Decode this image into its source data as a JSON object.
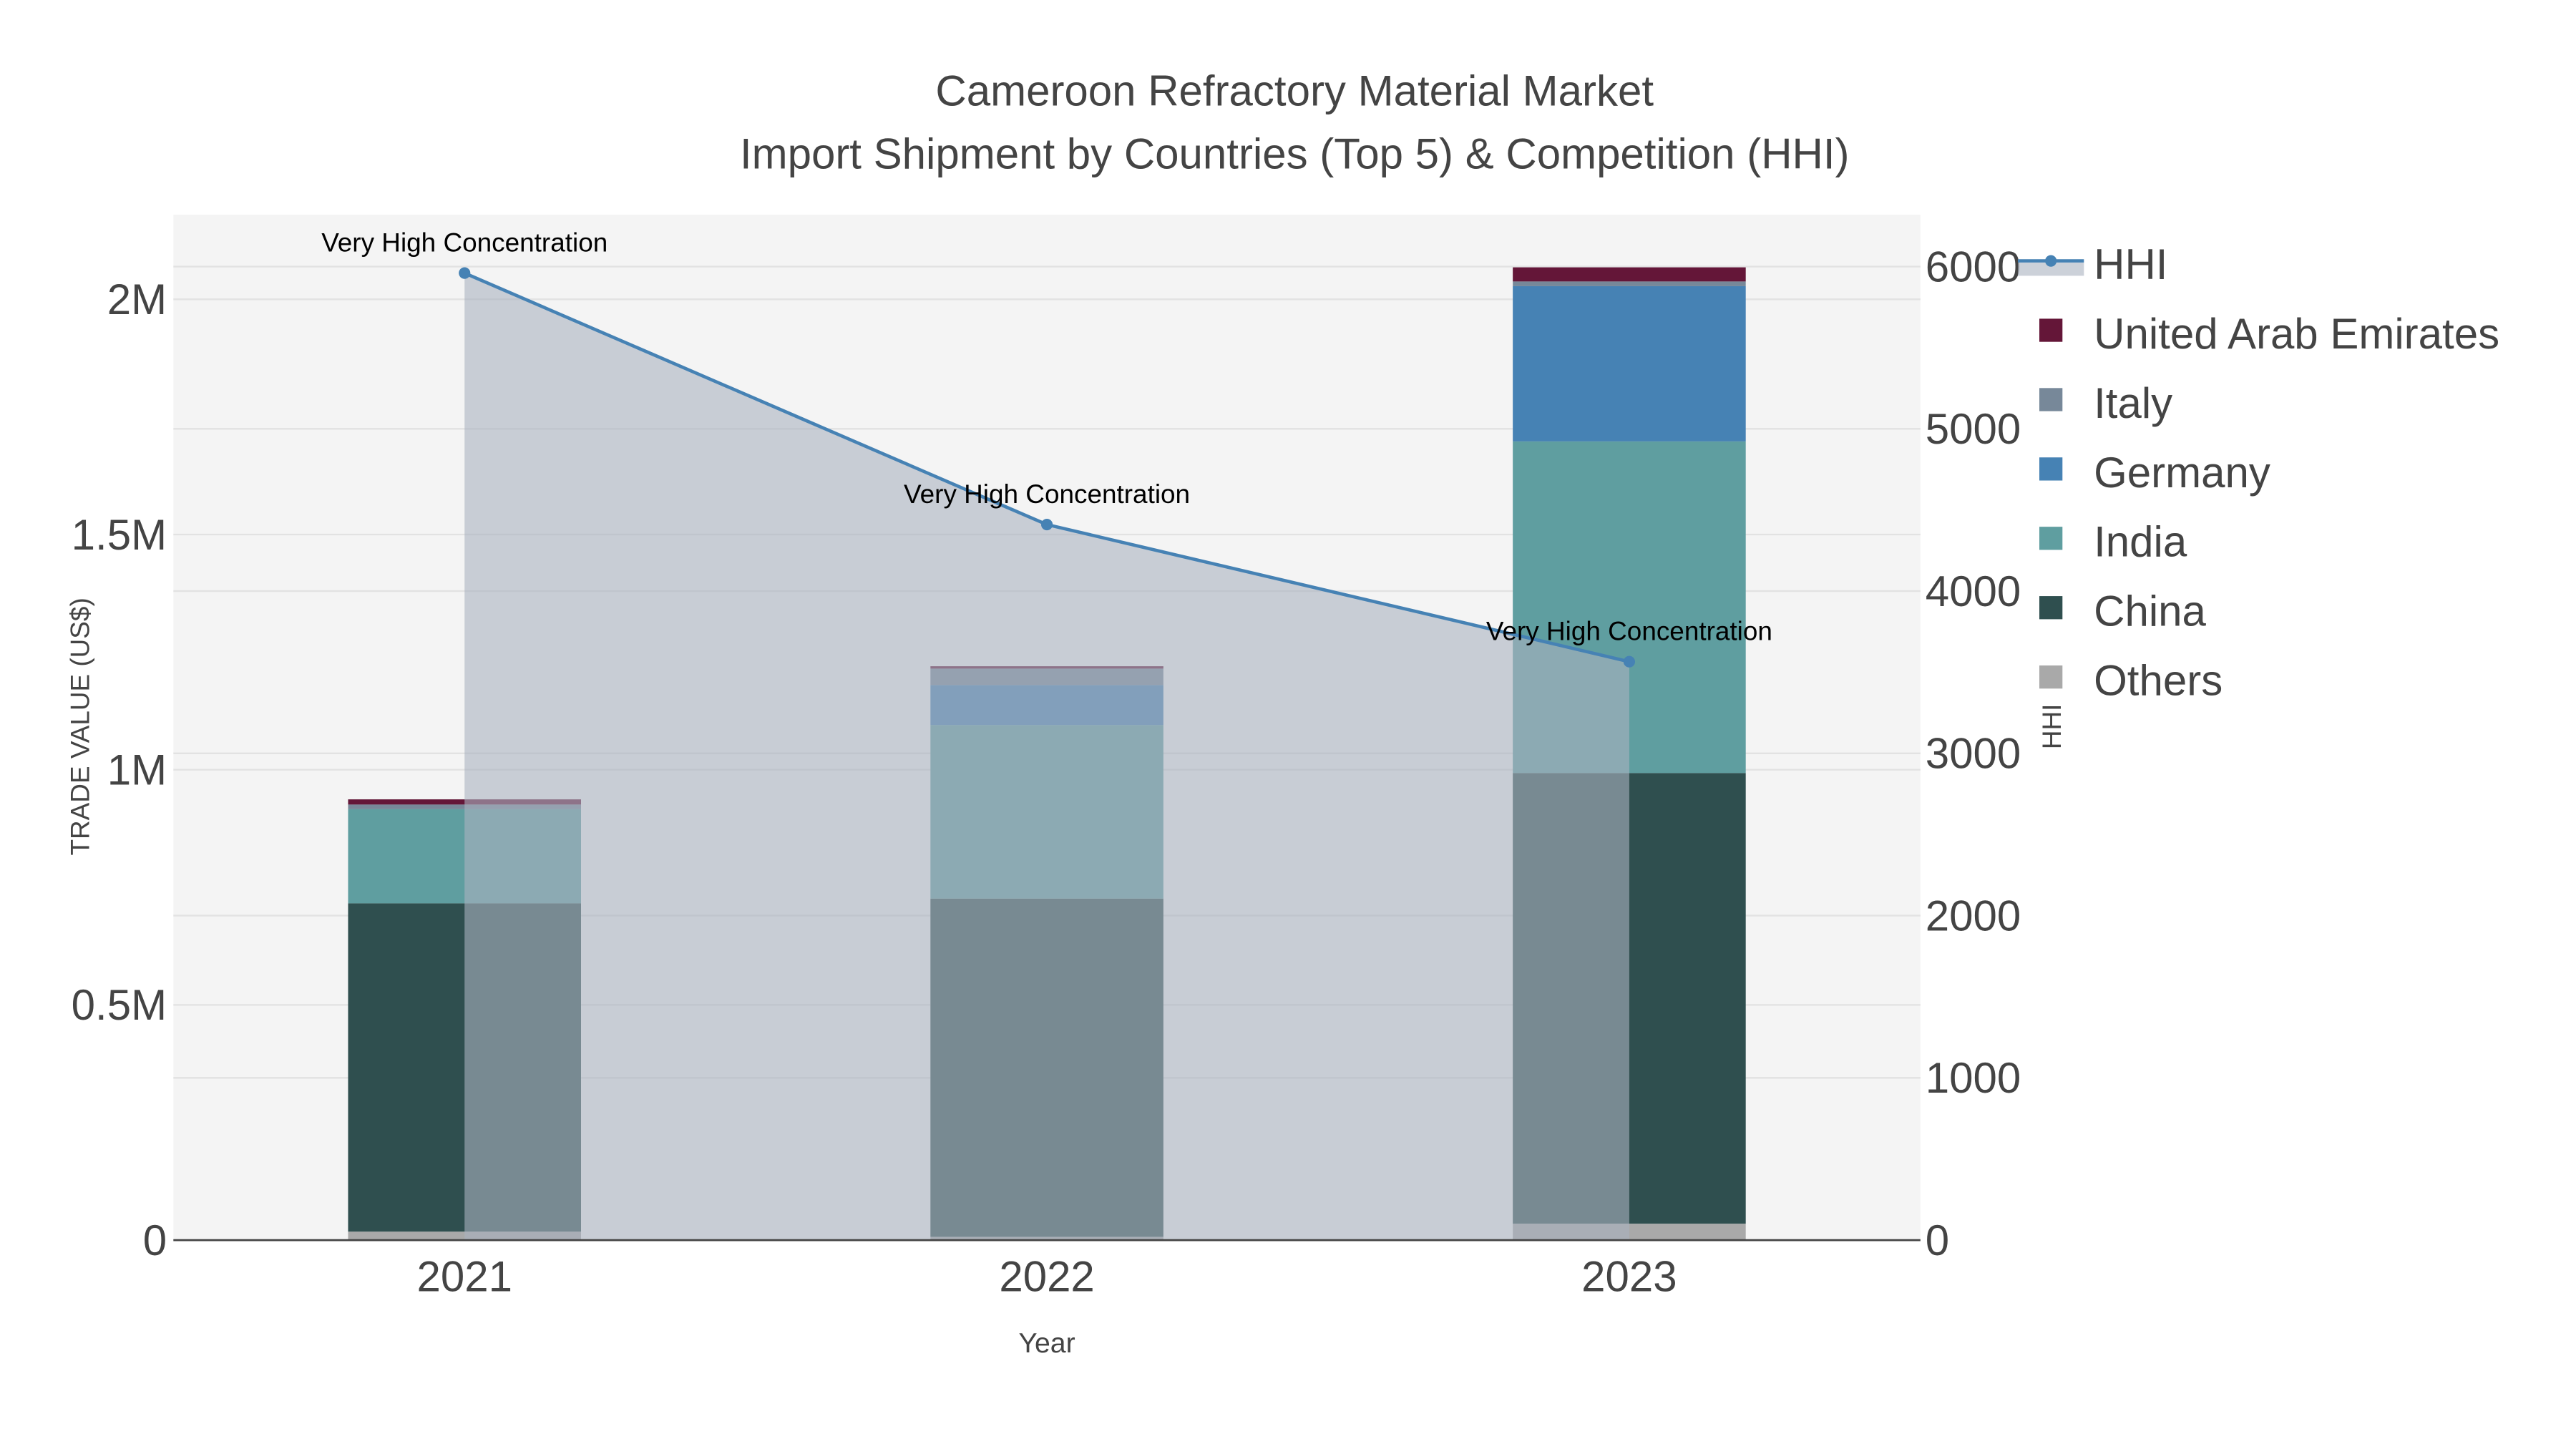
{
  "chart_data": {
    "type": "bar",
    "title": "Cameroon Refractory Material Market",
    "subtitle": "Import Shipment by Countries (Top 5) & Competition (HHI)",
    "xlabel": "Year",
    "ylabel": "TRADE VALUE (US$)",
    "y2label": "HHI",
    "categories": [
      "2021",
      "2022",
      "2023"
    ],
    "ylim": [
      0,
      2180000
    ],
    "y2lim": [
      0,
      6320
    ],
    "yticks": [
      {
        "v": 0,
        "label": "0"
      },
      {
        "v": 500000,
        "label": "0.5M"
      },
      {
        "v": 1000000,
        "label": "1M"
      },
      {
        "v": 1500000,
        "label": "1.5M"
      },
      {
        "v": 2000000,
        "label": "2M"
      }
    ],
    "y2ticks": [
      {
        "v": 0,
        "label": "0"
      },
      {
        "v": 1000,
        "label": "1000"
      },
      {
        "v": 2000,
        "label": "2000"
      },
      {
        "v": 3000,
        "label": "3000"
      },
      {
        "v": 4000,
        "label": "4000"
      },
      {
        "v": 5000,
        "label": "5000"
      },
      {
        "v": 6000,
        "label": "6000"
      }
    ],
    "series": [
      {
        "name": "Others",
        "color": "#a9a9a9",
        "values": [
          18000,
          7000,
          35000
        ]
      },
      {
        "name": "China",
        "color": "#2f4f4f",
        "values": [
          698000,
          719000,
          958000
        ]
      },
      {
        "name": "India",
        "color": "#5f9ea0",
        "values": [
          200000,
          369000,
          705000
        ]
      },
      {
        "name": "Germany",
        "color": "#4682b4",
        "values": [
          0,
          85000,
          330000
        ]
      },
      {
        "name": "Italy",
        "color": "#778899",
        "values": [
          10000,
          35000,
          10000
        ]
      },
      {
        "name": "United Arab Emirates",
        "color": "#641638",
        "values": [
          11000,
          5000,
          30000
        ]
      }
    ],
    "line": {
      "name": "HHI",
      "color": "#4682b4",
      "values": [
        5960,
        4410,
        3565
      ],
      "annotations": [
        "Very High Concentration",
        "Very High Concentration",
        "Very High Concentration"
      ]
    },
    "legend_position": "right"
  }
}
